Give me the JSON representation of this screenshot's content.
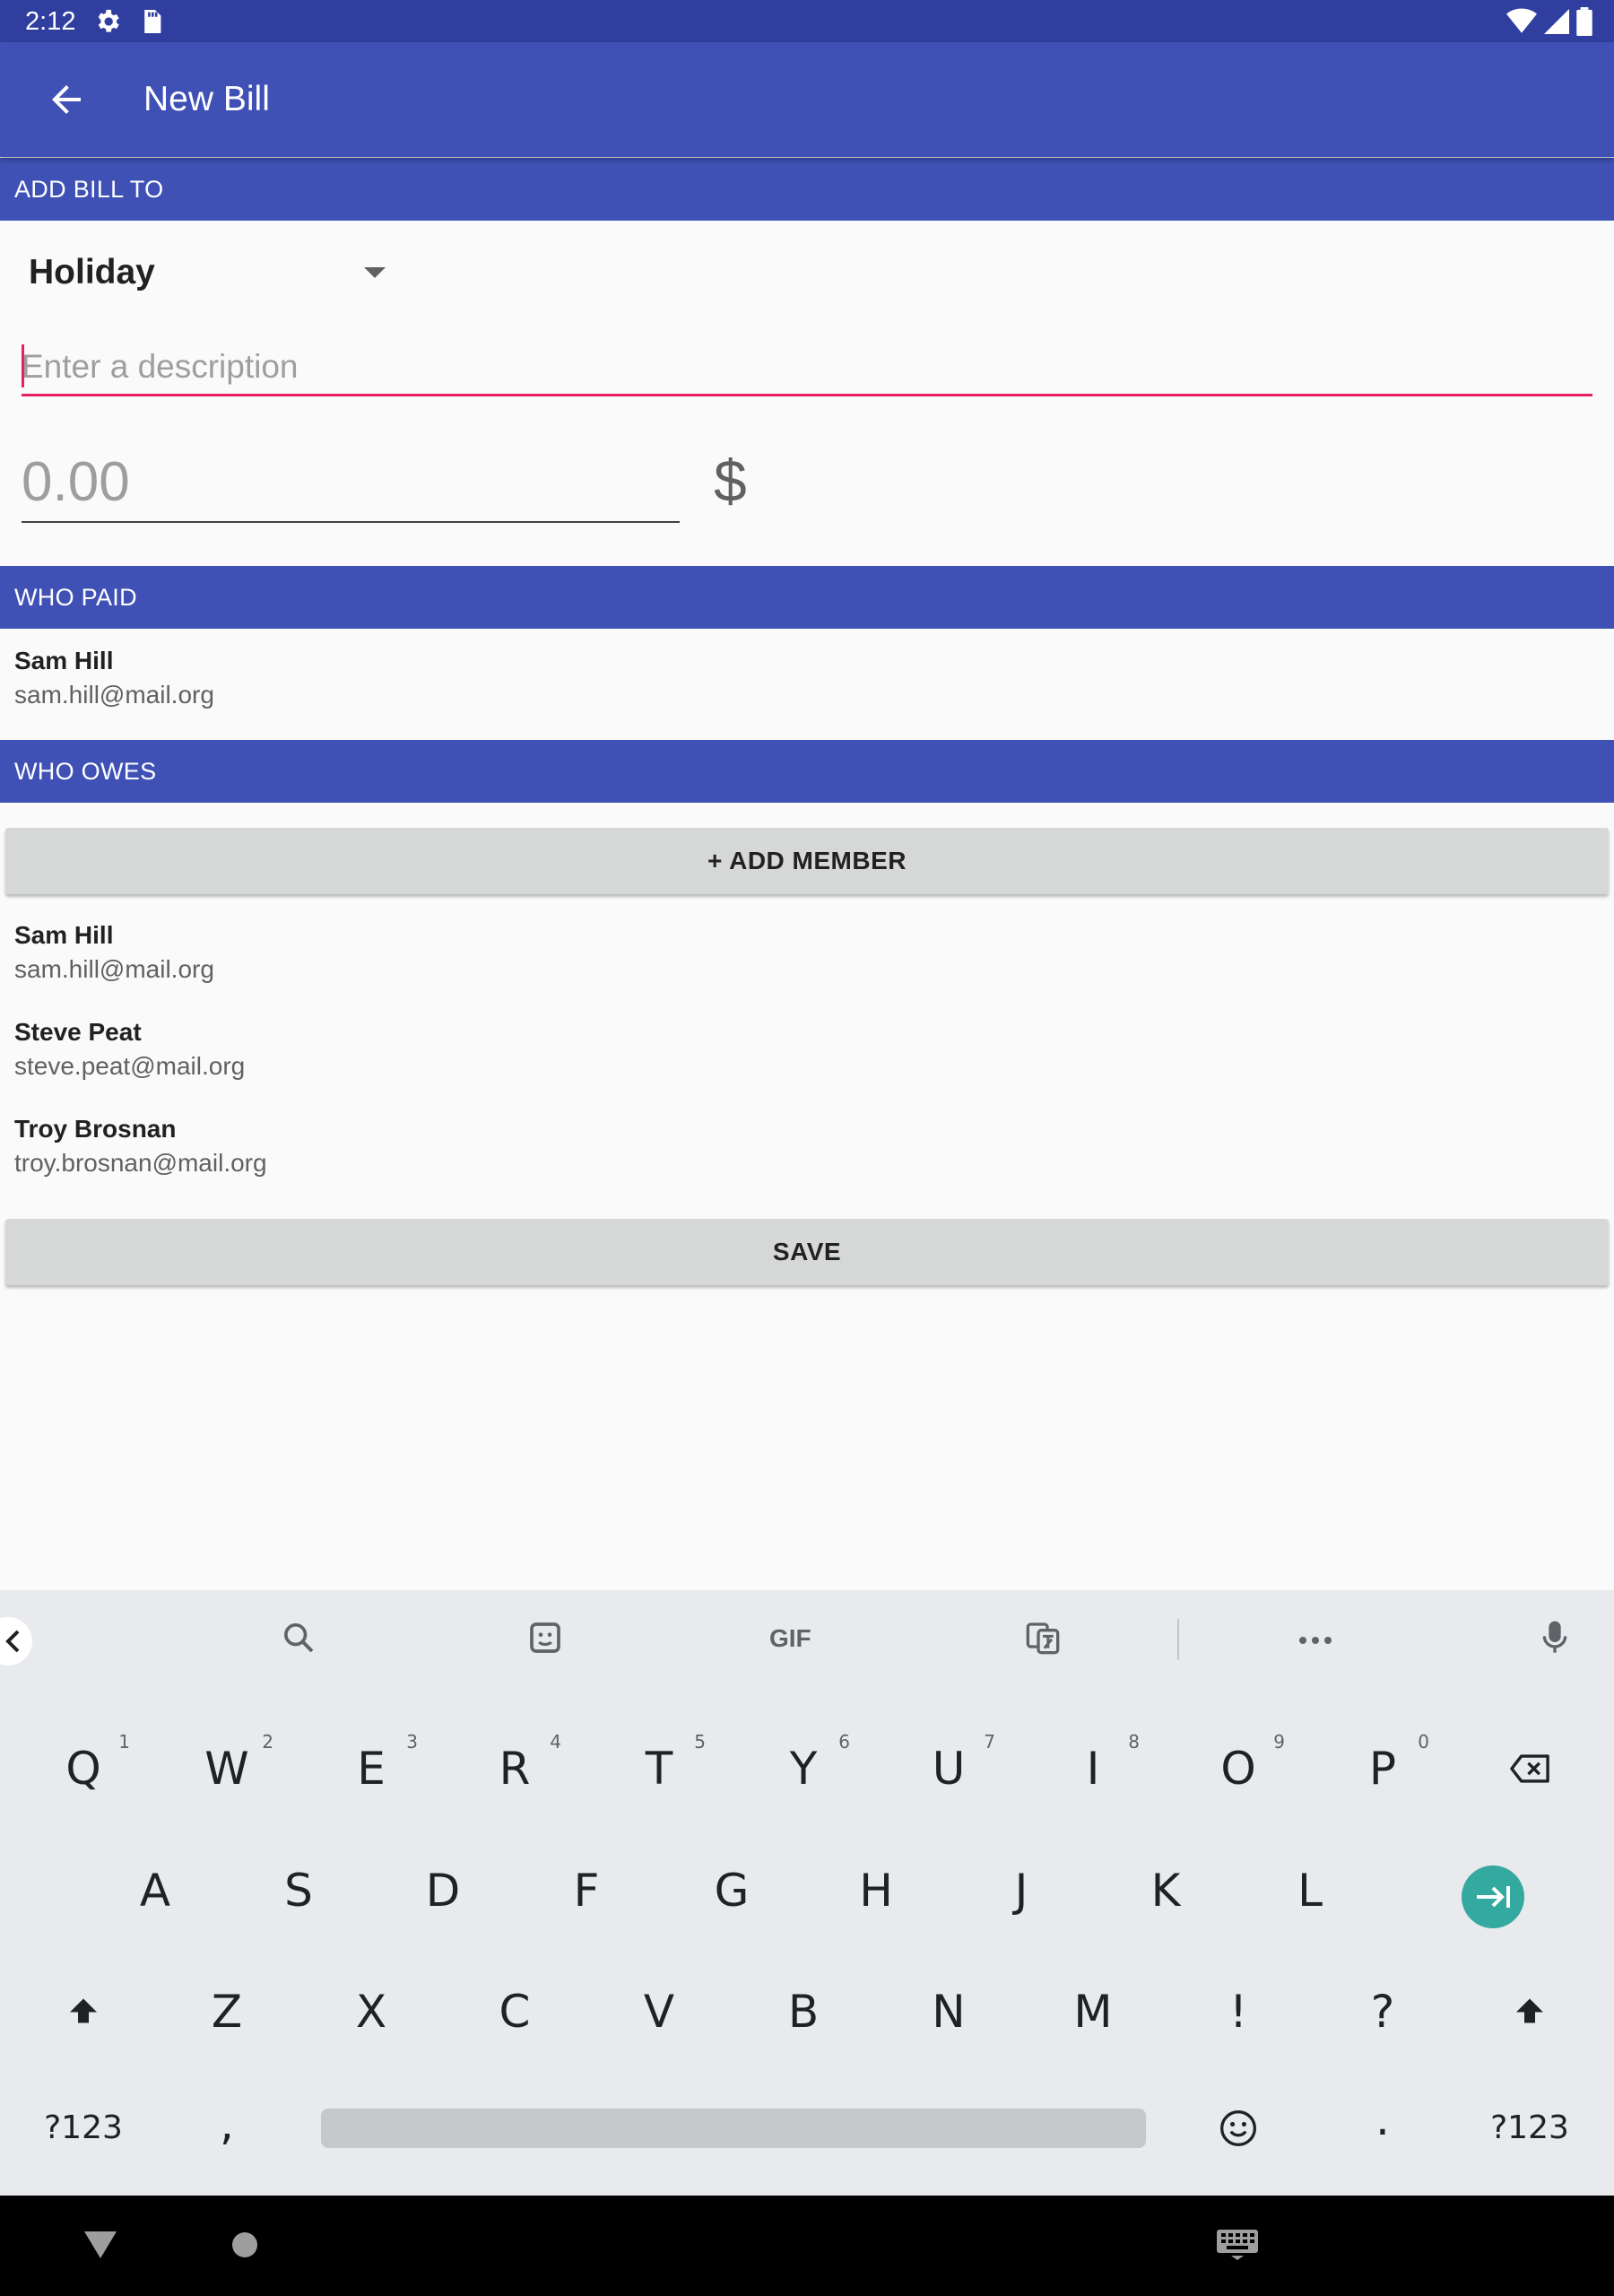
{
  "status_bar": {
    "time": "2:12",
    "icons": [
      "gear-icon",
      "sd-card-icon",
      "wifi-icon",
      "signal-icon",
      "battery-icon"
    ]
  },
  "toolbar": {
    "title": "New Bill",
    "back_icon": "arrow-back-icon"
  },
  "sections": {
    "add_bill_to": "ADD BILL TO",
    "who_paid": "WHO PAID",
    "who_owes": "WHO OWES"
  },
  "group_select": {
    "value": "Holiday"
  },
  "description": {
    "placeholder": "Enter a description",
    "value": ""
  },
  "amount": {
    "placeholder": "0.00",
    "currency": "$"
  },
  "payer": {
    "name": "Sam Hill",
    "email": "sam.hill@mail.org"
  },
  "add_member_label": "+ ADD MEMBER",
  "members": [
    {
      "name": "Sam Hill",
      "email": "sam.hill@mail.org"
    },
    {
      "name": "Steve Peat",
      "email": "steve.peat@mail.org"
    },
    {
      "name": "Troy Brosnan",
      "email": "troy.brosnan@mail.org"
    }
  ],
  "save_label": "SAVE",
  "keyboard": {
    "suggestions": {
      "gif": "GIF"
    },
    "row1": [
      "Q",
      "W",
      "E",
      "R",
      "T",
      "Y",
      "U",
      "I",
      "O",
      "P"
    ],
    "row1_hints": [
      "1",
      "2",
      "3",
      "4",
      "5",
      "6",
      "7",
      "8",
      "9",
      "0"
    ],
    "row2": [
      "A",
      "S",
      "D",
      "F",
      "G",
      "H",
      "J",
      "K",
      "L"
    ],
    "row3": [
      "Z",
      "X",
      "C",
      "V",
      "B",
      "N",
      "M",
      "!",
      "?"
    ],
    "row4": {
      "symbols_left": "?123",
      "comma": ",",
      "period": ".",
      "symbols_right": "?123"
    }
  },
  "colors": {
    "primary": "#3f51b5",
    "primary_dark": "#303f9f",
    "accent": "#e91e63",
    "button": "#d6d7d7",
    "enter": "#33a9a0"
  }
}
